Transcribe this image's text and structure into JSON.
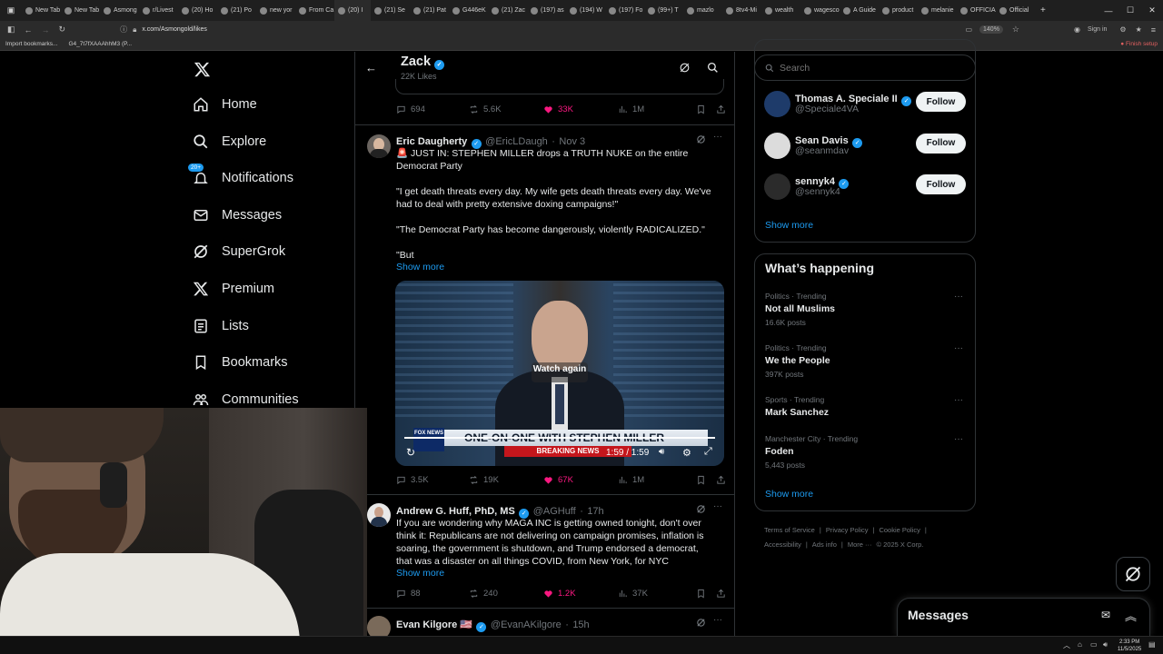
{
  "browser": {
    "tabs": [
      "New Tab",
      "New Tab",
      "Asmong",
      "r/Livest",
      "(20) Ho",
      "(21) Po",
      "new yor",
      "From Ca",
      "(20) I",
      "(21) Se",
      "(21) Pat",
      "G446eK",
      "(21) Zac",
      "(197) as",
      "(194) W",
      "(197) Fo",
      "(99+) T",
      "mazlo",
      "8tv4-Mi",
      "wealth",
      "wagescomp",
      "A Guide",
      "product",
      "melanie",
      "OFFICIA",
      "Official"
    ],
    "active_tab_index": 8,
    "url": "x.com/Asmongold/likes",
    "zoom": "140%",
    "sign_in": "Sign in",
    "bookmarks": [
      "Import bookmarks...",
      "G4_7t7fXAAAhhM3 (P..."
    ],
    "finish_setup": "Finish setup",
    "clock_time": "2:33 PM",
    "clock_date": "11/5/2025"
  },
  "nav": {
    "items": [
      {
        "label": "Home",
        "icon": "home-icon"
      },
      {
        "label": "Explore",
        "icon": "search-icon"
      },
      {
        "label": "Notifications",
        "icon": "bell-icon",
        "badge": "20+"
      },
      {
        "label": "Messages",
        "icon": "mail-icon"
      },
      {
        "label": "SuperGrok",
        "icon": "grok-icon"
      },
      {
        "label": "Premium",
        "icon": "x-logo-icon"
      },
      {
        "label": "Lists",
        "icon": "list-icon"
      },
      {
        "label": "Bookmarks",
        "icon": "bookmark-icon"
      },
      {
        "label": "Communities",
        "icon": "communities-icon"
      }
    ]
  },
  "header": {
    "name": "Zack",
    "subtitle": "22K Likes"
  },
  "tweets": [
    {
      "partial_top": true,
      "replies": "694",
      "reposts": "5.6K",
      "likes": "33K",
      "views": "1M"
    },
    {
      "name": "Eric Daugherty",
      "handle": "@EricLDaugh",
      "time": "Nov 3",
      "lines": [
        "🚨 JUST IN: STEPHEN MILLER drops a TRUTH NUKE on the entire",
        "Democrat Party",
        "",
        "\"I get death threats every day. My wife gets death threats every day. We've",
        "had to deal with pretty extensive doxing campaigns!\"",
        "",
        "\"The Democrat Party has become dangerously, violently RADICALIZED.\"",
        "",
        "\"But"
      ],
      "show_more": "Show more",
      "video": {
        "watch_again": "Watch again",
        "chyron": "ONE-ON-ONE WITH STEPHEN MILLER",
        "breaking": "BREAKING NEWS",
        "time": "1:59 / 1:59",
        "network": "FOX NEWS"
      },
      "replies": "3.5K",
      "reposts": "19K",
      "likes": "67K",
      "views": "1M"
    },
    {
      "name": "Andrew G. Huff, PhD, MS",
      "handle": "@AGHuff",
      "time": "17h",
      "lines": [
        "If you are wondering why MAGA INC is getting owned tonight, don't over",
        "think it: Republicans are not delivering on campaign promises, inflation is",
        "soaring, the government is shutdown, and Trump endorsed a democrat,",
        "that was a disaster on all things COVID, from New York, for NYC"
      ],
      "show_more": "Show more",
      "replies": "88",
      "reposts": "240",
      "likes": "1.2K",
      "views": "37K"
    },
    {
      "name": "Evan Kilgore 🇺🇸",
      "handle": "@EvanAKilgore",
      "time": "15h"
    }
  ],
  "search": {
    "placeholder": "Search"
  },
  "who_to_follow": {
    "people": [
      {
        "name": "Thomas A. Speciale II",
        "handle": "@Speciale4VA",
        "button": "Follow"
      },
      {
        "name": "Sean Davis",
        "handle": "@seanmdav",
        "button": "Follow"
      },
      {
        "name": "sennyk4",
        "handle": "@sennyk4",
        "button": "Follow"
      }
    ],
    "show_more": "Show more"
  },
  "happening": {
    "title": "What’s happening",
    "trends": [
      {
        "context": "Politics · Trending",
        "topic": "Not all Muslims",
        "count": "16.6K posts"
      },
      {
        "context": "Politics · Trending",
        "topic": "We the People",
        "count": "397K posts"
      },
      {
        "context": "Sports · Trending",
        "topic": "Mark Sanchez",
        "count": ""
      },
      {
        "context": "Manchester City · Trending",
        "topic": "Foden",
        "count": "5,443 posts"
      }
    ],
    "show_more": "Show more"
  },
  "footer": {
    "links": [
      "Terms of Service",
      "|",
      "Privacy Policy",
      "|",
      "Cookie Policy",
      "|"
    ],
    "links2": [
      "Accessibility",
      "|",
      "Ads info",
      "|",
      "More ···",
      "© 2025 X Corp."
    ]
  },
  "messages_drawer": {
    "title": "Messages"
  },
  "colors": {
    "accent": "#1d9bf0",
    "like": "#f91880",
    "bg": "#000000",
    "border": "#2f3336"
  }
}
